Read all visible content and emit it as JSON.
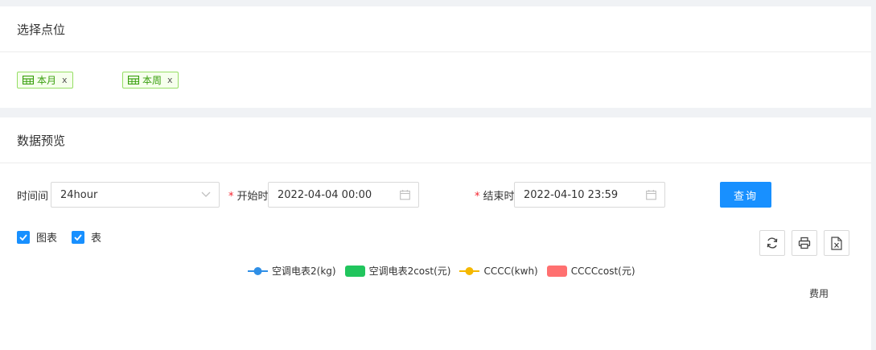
{
  "select_points": {
    "title": "选择点位",
    "tags": [
      {
        "label": "本月",
        "close": "x"
      },
      {
        "label": "本周",
        "close": "x"
      }
    ]
  },
  "preview": {
    "title": "数据预览",
    "interval": {
      "label": "时间间",
      "value": "24hour"
    },
    "start": {
      "required_mark": "*",
      "label": "开始时",
      "value": "2022-04-04 00:00"
    },
    "end": {
      "required_mark": "*",
      "label": "结束时",
      "value": "2022-04-10 23:59"
    },
    "query_button": "查询",
    "checkboxes": [
      {
        "label": "图表",
        "checked": true
      },
      {
        "label": "表",
        "checked": true
      }
    ],
    "tools": [
      "refresh-icon",
      "print-icon",
      "excel-export-icon"
    ]
  },
  "chart_data": {
    "type": "bar",
    "legend": [
      {
        "name": "空调电表2(kg)",
        "color": "#2f8fe6",
        "style": "line"
      },
      {
        "name": "空调电表2cost(元)",
        "color": "#21c55d",
        "style": "bar"
      },
      {
        "name": "CCCC(kwh)",
        "color": "#f5b800",
        "style": "line"
      },
      {
        "name": "CCCCcost(元)",
        "color": "#ff7070",
        "style": "bar"
      }
    ],
    "y2_name": "费用",
    "legend_position": "top-center"
  }
}
